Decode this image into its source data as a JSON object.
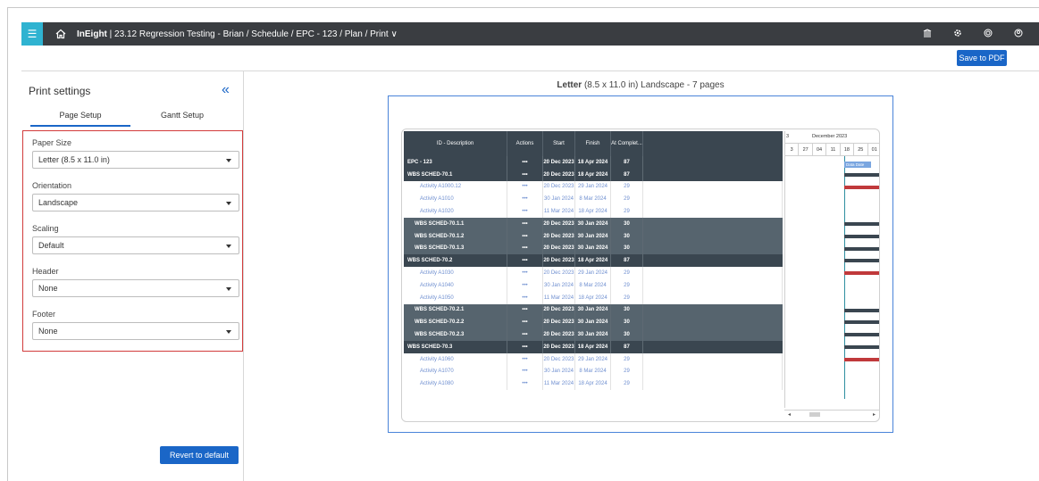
{
  "header": {
    "app_name": "InEight",
    "breadcrumb": "| 23.12 Regression Testing - Brian / Schedule / EPC - 123 / Plan / Print ∨",
    "icons": [
      "home-icon",
      "bank-icon",
      "settings-icon",
      "help-icon",
      "user-icon"
    ]
  },
  "toolbar": {
    "save_pdf_label": "Save to PDF"
  },
  "left_panel": {
    "title": "Print settings",
    "collapse_icon": "«",
    "tabs": [
      {
        "label": "Page Setup",
        "active": true
      },
      {
        "label": "Gantt Setup",
        "active": false
      }
    ],
    "fields": [
      {
        "label": "Paper Size",
        "value": "Letter (8.5 x 11.0 in)"
      },
      {
        "label": "Orientation",
        "value": "Landscape"
      },
      {
        "label": "Scaling",
        "value": "Default"
      },
      {
        "label": "Header",
        "value": "None"
      },
      {
        "label": "Footer",
        "value": "None"
      }
    ],
    "revert_label": "Revert to default"
  },
  "preview": {
    "paper_bold": "Letter",
    "paper_rest": " (8.5 x 11.0 in) Landscape - 7 pages",
    "columns": [
      "ID - Description",
      "Actions",
      "Start",
      "Finish",
      "At Complet..."
    ],
    "rows": [
      {
        "type": "dark",
        "id": "EPC - 123",
        "actions": "•••",
        "start": "20 Dec 2023",
        "finish": "18 Apr 2024",
        "ac": "87",
        "bar": "none"
      },
      {
        "type": "dark",
        "id": "WBS SCHED-70.1",
        "actions": "•••",
        "start": "20 Dec 2023",
        "finish": "18 Apr 2024",
        "ac": "87",
        "bar": "dark"
      },
      {
        "type": "light",
        "id": "Activity A1000.12",
        "actions": "•••",
        "start": "20 Dec 2023",
        "finish": "29 Jan 2024",
        "ac": "29",
        "bar": "red"
      },
      {
        "type": "light",
        "id": "Activity A1010",
        "actions": "•••",
        "start": "30 Jan 2024",
        "finish": "8 Mar 2024",
        "ac": "29",
        "bar": "none"
      },
      {
        "type": "light",
        "id": "Activity A1020",
        "actions": "•••",
        "start": "11 Mar 2024",
        "finish": "18 Apr 2024",
        "ac": "29",
        "bar": "none"
      },
      {
        "type": "mid",
        "id": "WBS SCHED-70.1.1",
        "actions": "•••",
        "start": "20 Dec 2023",
        "finish": "30 Jan 2024",
        "ac": "30",
        "bar": "dark"
      },
      {
        "type": "mid",
        "id": "WBS SCHED-70.1.2",
        "actions": "•••",
        "start": "20 Dec 2023",
        "finish": "30 Jan 2024",
        "ac": "30",
        "bar": "dark"
      },
      {
        "type": "mid",
        "id": "WBS SCHED-70.1.3",
        "actions": "•••",
        "start": "20 Dec 2023",
        "finish": "30 Jan 2024",
        "ac": "30",
        "bar": "dark"
      },
      {
        "type": "dark",
        "id": "WBS SCHED-70.2",
        "actions": "•••",
        "start": "20 Dec 2023",
        "finish": "18 Apr 2024",
        "ac": "87",
        "bar": "dark"
      },
      {
        "type": "light",
        "id": "Activity A1030",
        "actions": "•••",
        "start": "20 Dec 2023",
        "finish": "29 Jan 2024",
        "ac": "29",
        "bar": "red"
      },
      {
        "type": "light",
        "id": "Activity A1040",
        "actions": "•••",
        "start": "30 Jan 2024",
        "finish": "8 Mar 2024",
        "ac": "29",
        "bar": "none"
      },
      {
        "type": "light",
        "id": "Activity A1050",
        "actions": "•••",
        "start": "11 Mar 2024",
        "finish": "18 Apr 2024",
        "ac": "29",
        "bar": "none"
      },
      {
        "type": "mid",
        "id": "WBS SCHED-70.2.1",
        "actions": "•••",
        "start": "20 Dec 2023",
        "finish": "30 Jan 2024",
        "ac": "30",
        "bar": "dark"
      },
      {
        "type": "mid",
        "id": "WBS SCHED-70.2.2",
        "actions": "•••",
        "start": "20 Dec 2023",
        "finish": "30 Jan 2024",
        "ac": "30",
        "bar": "dark"
      },
      {
        "type": "mid",
        "id": "WBS SCHED-70.2.3",
        "actions": "•••",
        "start": "20 Dec 2023",
        "finish": "30 Jan 2024",
        "ac": "30",
        "bar": "dark"
      },
      {
        "type": "dark",
        "id": "WBS SCHED-70.3",
        "actions": "•••",
        "start": "20 Dec 2023",
        "finish": "18 Apr 2024",
        "ac": "87",
        "bar": "dark"
      },
      {
        "type": "light",
        "id": "Activity A1060",
        "actions": "•••",
        "start": "20 Dec 2023",
        "finish": "29 Jan 2024",
        "ac": "29",
        "bar": "red"
      },
      {
        "type": "light",
        "id": "Activity A1070",
        "actions": "•••",
        "start": "30 Jan 2024",
        "finish": "8 Mar 2024",
        "ac": "29",
        "bar": "none"
      },
      {
        "type": "light",
        "id": "Activity A1080",
        "actions": "•••",
        "start": "11 Mar 2024",
        "finish": "18 Apr 2024",
        "ac": "29",
        "bar": "none"
      }
    ],
    "gantt": {
      "month": "December 2023",
      "month_prefix": "3",
      "days": [
        "3",
        "27",
        "04",
        "11",
        "18",
        "25",
        "01"
      ],
      "data_date_label": "Data Date"
    },
    "colors": {
      "bar_dark": "#3a4650",
      "bar_red": "#c0393b",
      "accent": "#1a66c7"
    }
  }
}
